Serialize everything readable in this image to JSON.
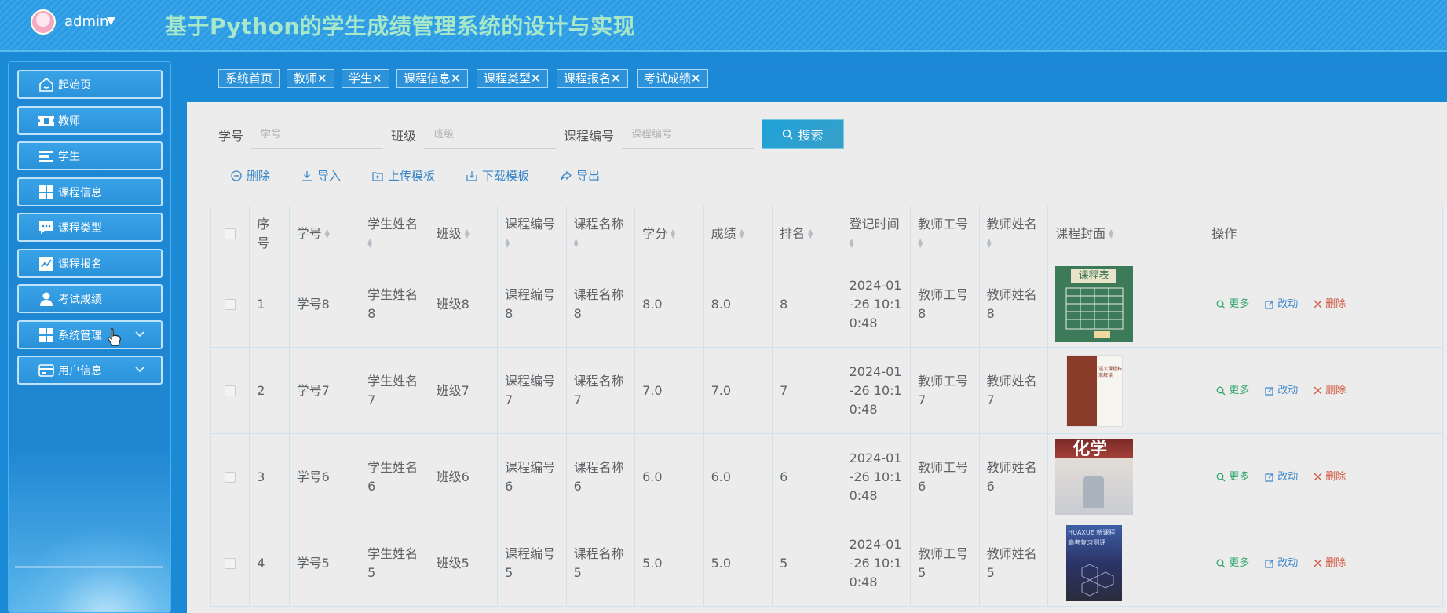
{
  "header": {
    "user": "admin",
    "title": "基于Python的学生成绩管理系统的设计与实现"
  },
  "sidebar": {
    "items": [
      {
        "label": "起始页",
        "icon": "home-icon"
      },
      {
        "label": "教师",
        "icon": "ticket-icon"
      },
      {
        "label": "学生",
        "icon": "list-icon"
      },
      {
        "label": "课程信息",
        "icon": "grid-icon"
      },
      {
        "label": "课程类型",
        "icon": "chat-icon"
      },
      {
        "label": "课程报名",
        "icon": "chart-icon"
      },
      {
        "label": "考试成绩",
        "icon": "person-icon"
      },
      {
        "label": "系统管理",
        "icon": "grid-icon"
      },
      {
        "label": "用户信息",
        "icon": "card-icon"
      }
    ]
  },
  "tabs": [
    "系统首页",
    "教师✕",
    "学生✕",
    "课程信息✕",
    "课程类型✕",
    "课程报名✕",
    "考试成绩✕"
  ],
  "search": {
    "fields": [
      {
        "label": "学号",
        "placeholder": "学号"
      },
      {
        "label": "班级",
        "placeholder": "班级"
      },
      {
        "label": "课程编号",
        "placeholder": "课程编号"
      }
    ],
    "button": "搜索"
  },
  "toolbar": {
    "delete": "删除",
    "import": "导入",
    "upload_template": "上传模板",
    "download_template": "下载模板",
    "export": "导出"
  },
  "table": {
    "headers": {
      "index": "序号",
      "student_id": "学号",
      "student_name": "学生姓名",
      "class": "班级",
      "course_id": "课程编号",
      "course_name": "课程名称",
      "credit": "学分",
      "score": "成绩",
      "rank": "排名",
      "time": "登记时间",
      "teacher_id": "教师工号",
      "teacher_name": "教师姓名",
      "cover": "课程封面",
      "ops": "操作"
    },
    "ops": {
      "more": "更多",
      "edit": "改动",
      "delete": "删除"
    },
    "rows": [
      {
        "index": "1",
        "student_id": "学号8",
        "student_name": "学生姓名8",
        "class": "班级8",
        "course_id": "课程编号8",
        "course_name": "课程名称8",
        "credit": "8.0",
        "score": "8.0",
        "rank": "8",
        "time": "2024-01-26 10:10:48",
        "teacher_id": "教师工号8",
        "teacher_name": "教师姓名8",
        "cover_text": "课程表"
      },
      {
        "index": "2",
        "student_id": "学号7",
        "student_name": "学生姓名7",
        "class": "班级7",
        "course_id": "课程编号7",
        "course_name": "课程名称7",
        "credit": "7.0",
        "score": "7.0",
        "rank": "7",
        "time": "2024-01-26 10:10:48",
        "teacher_id": "教师工号7",
        "teacher_name": "教师姓名7",
        "cover_text": "语文课程标准解读"
      },
      {
        "index": "3",
        "student_id": "学号6",
        "student_name": "学生姓名6",
        "class": "班级6",
        "course_id": "课程编号6",
        "course_name": "课程名称6",
        "credit": "6.0",
        "score": "6.0",
        "rank": "6",
        "time": "2024-01-26 10:10:48",
        "teacher_id": "教师工号6",
        "teacher_name": "教师姓名6",
        "cover_text": "化学"
      },
      {
        "index": "4",
        "student_id": "学号5",
        "student_name": "学生姓名5",
        "class": "班级5",
        "course_id": "课程编号5",
        "course_name": "课程名称5",
        "credit": "5.0",
        "score": "5.0",
        "rank": "5",
        "time": "2024-01-26 10:10:48",
        "teacher_id": "教师工号5",
        "teacher_name": "教师姓名5",
        "cover_text": "HUAXUE 新课程高考复习测评"
      }
    ]
  }
}
